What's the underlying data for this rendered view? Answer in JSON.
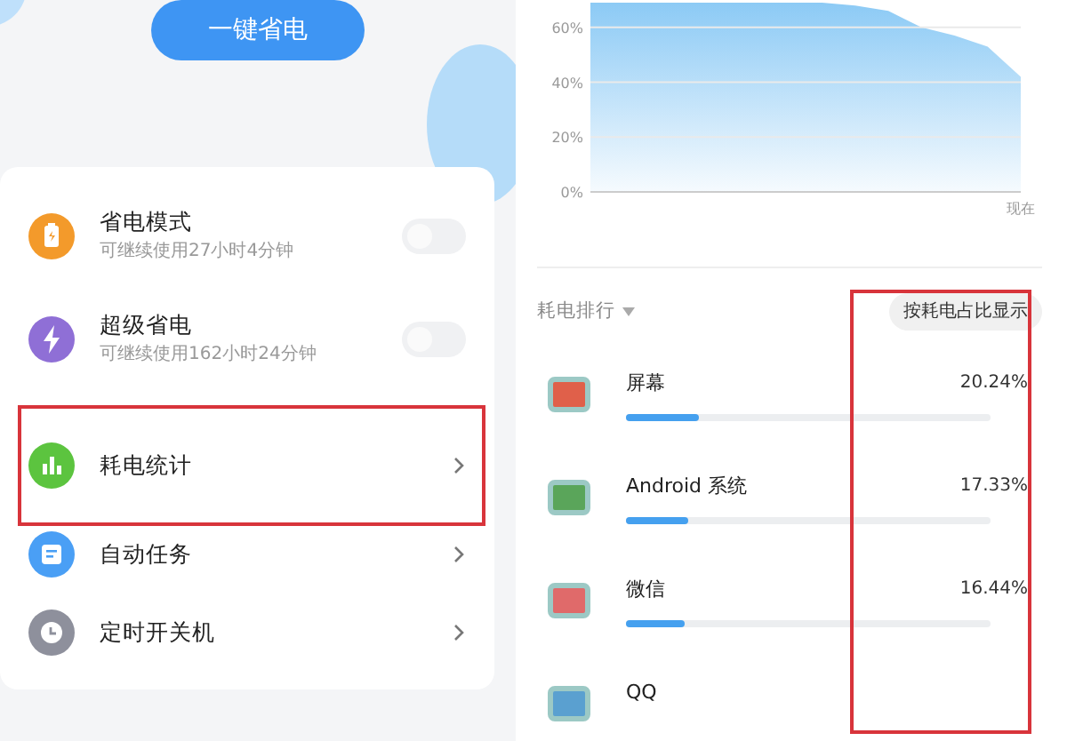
{
  "left_panel": {
    "save_button": "一键省电",
    "settings": [
      {
        "kind": "toggle",
        "title": "省电模式",
        "subtitle": "可继续使用27小时4分钟",
        "color": "#f39a2b",
        "on": false,
        "highlighted": false
      },
      {
        "kind": "toggle",
        "title": "超级省电",
        "subtitle": "可继续使用162小时24分钟",
        "color": "#8f6fd6",
        "on": false,
        "highlighted": false
      },
      {
        "kind": "link",
        "title": "耗电统计",
        "color": "#5cc43f",
        "highlighted": true
      },
      {
        "kind": "link",
        "title": "自动任务",
        "color": "#4a9ff5",
        "highlighted": false
      },
      {
        "kind": "link",
        "title": "定时开关机",
        "color": "#8e909c",
        "highlighted": false
      }
    ]
  },
  "right_panel": {
    "chart": {
      "axis_labels": [
        "60%",
        "40%",
        "20%",
        "0%"
      ],
      "time_label": "现在"
    },
    "ranking": {
      "title": "耗电排行",
      "sort_button": "按耗电占比显示",
      "percent_column_highlighted": true,
      "apps": [
        {
          "name": "屏幕",
          "percent": "20.24%",
          "level": 0.2,
          "color": "#e0604a"
        },
        {
          "name": "Android 系统",
          "percent": "17.33%",
          "level": 0.17,
          "color": "#5aa55a"
        },
        {
          "name": "微信",
          "percent": "16.44%",
          "level": 0.16,
          "color": "#e06a6a"
        },
        {
          "name": "QQ",
          "color": "#5aa0d0"
        }
      ]
    }
  }
}
